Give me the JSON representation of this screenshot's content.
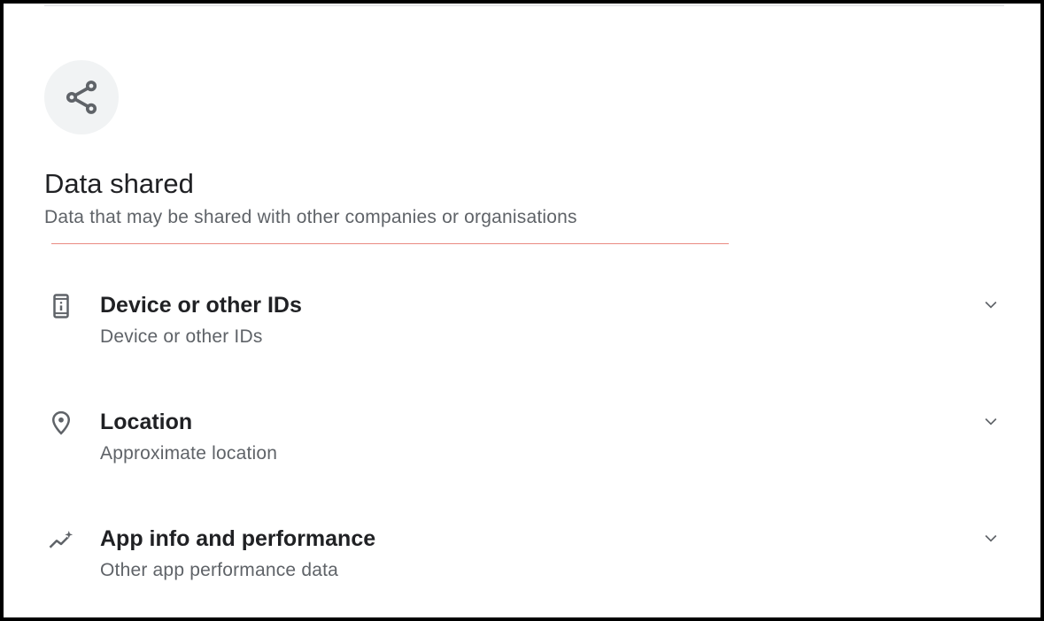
{
  "section": {
    "icon": "share-icon",
    "title": "Data shared",
    "subtitle": "Data that may be shared with other companies or organisations"
  },
  "items": [
    {
      "icon": "device-id-icon",
      "title": "Device or other IDs",
      "description": "Device or other IDs"
    },
    {
      "icon": "location-pin-icon",
      "title": "Location",
      "description": "Approximate location"
    },
    {
      "icon": "performance-icon",
      "title": "App info and performance",
      "description": "Other app performance data"
    }
  ],
  "colors": {
    "title_text": "#202124",
    "secondary_text": "#5f6368",
    "icon": "#5f6368",
    "icon_circle_bg": "#f1f3f4",
    "accent_line": "#ea8a82",
    "divider": "#dadce0",
    "frame_border": "#000000"
  }
}
